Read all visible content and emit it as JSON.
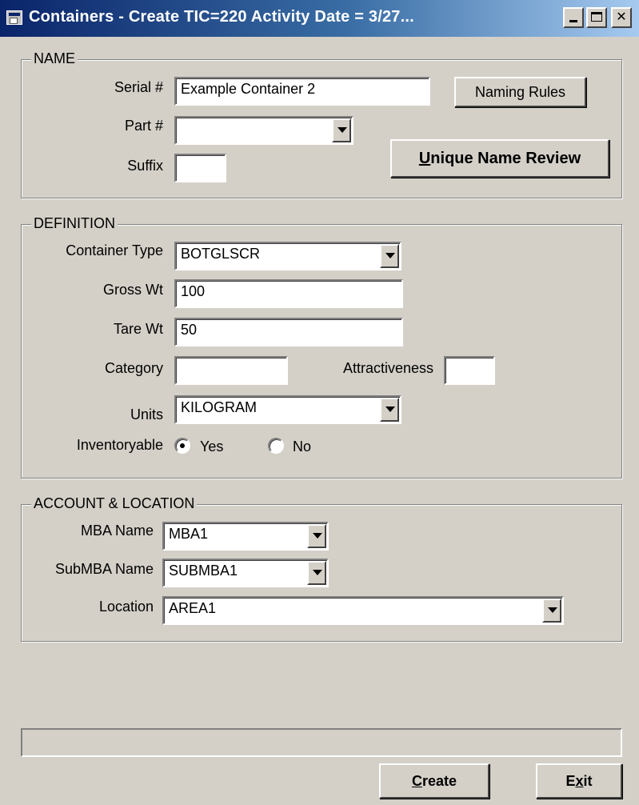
{
  "window": {
    "title": "Containers - Create    TIC=220    Activity Date = 3/27..."
  },
  "name_group": {
    "legend": "NAME",
    "serial_label": "Serial #",
    "serial_value": "Example Container 2",
    "part_label": "Part #",
    "part_value": "",
    "suffix_label": "Suffix",
    "suffix_value": "",
    "naming_rules_button": "Naming Rules",
    "unique_review_button_u": "U",
    "unique_review_button_rest": "nique Name Review"
  },
  "definition_group": {
    "legend": "DEFINITION",
    "container_type_label": "Container Type",
    "container_type_value": "BOTGLSCR",
    "gross_wt_label": "Gross Wt",
    "gross_wt_value": "100",
    "tare_wt_label": "Tare Wt",
    "tare_wt_value": "50",
    "category_label": "Category",
    "category_value": "",
    "attractiveness_label": "Attractiveness",
    "attractiveness_value": "",
    "units_label": "Units",
    "units_value": "KILOGRAM",
    "inventoryable_label": "Inventoryable",
    "yes_label": "Yes",
    "no_label": "No",
    "inventoryable_selected": "Yes"
  },
  "account_group": {
    "legend": "ACCOUNT & LOCATION",
    "mba_label": "MBA Name",
    "mba_value": "MBA1",
    "submba_label": "SubMBA Name",
    "submba_value": "SUBMBA1",
    "location_label": "Location",
    "location_value": "AREA1"
  },
  "footer": {
    "status_text": "",
    "create_button_u": "C",
    "create_button_rest": "reate",
    "exit_button_pre": "E",
    "exit_button_u": "x",
    "exit_button_rest": "it"
  },
  "colors": {
    "face": "#d4d0c8",
    "title_start": "#0a246a",
    "title_end": "#a6caf0"
  }
}
